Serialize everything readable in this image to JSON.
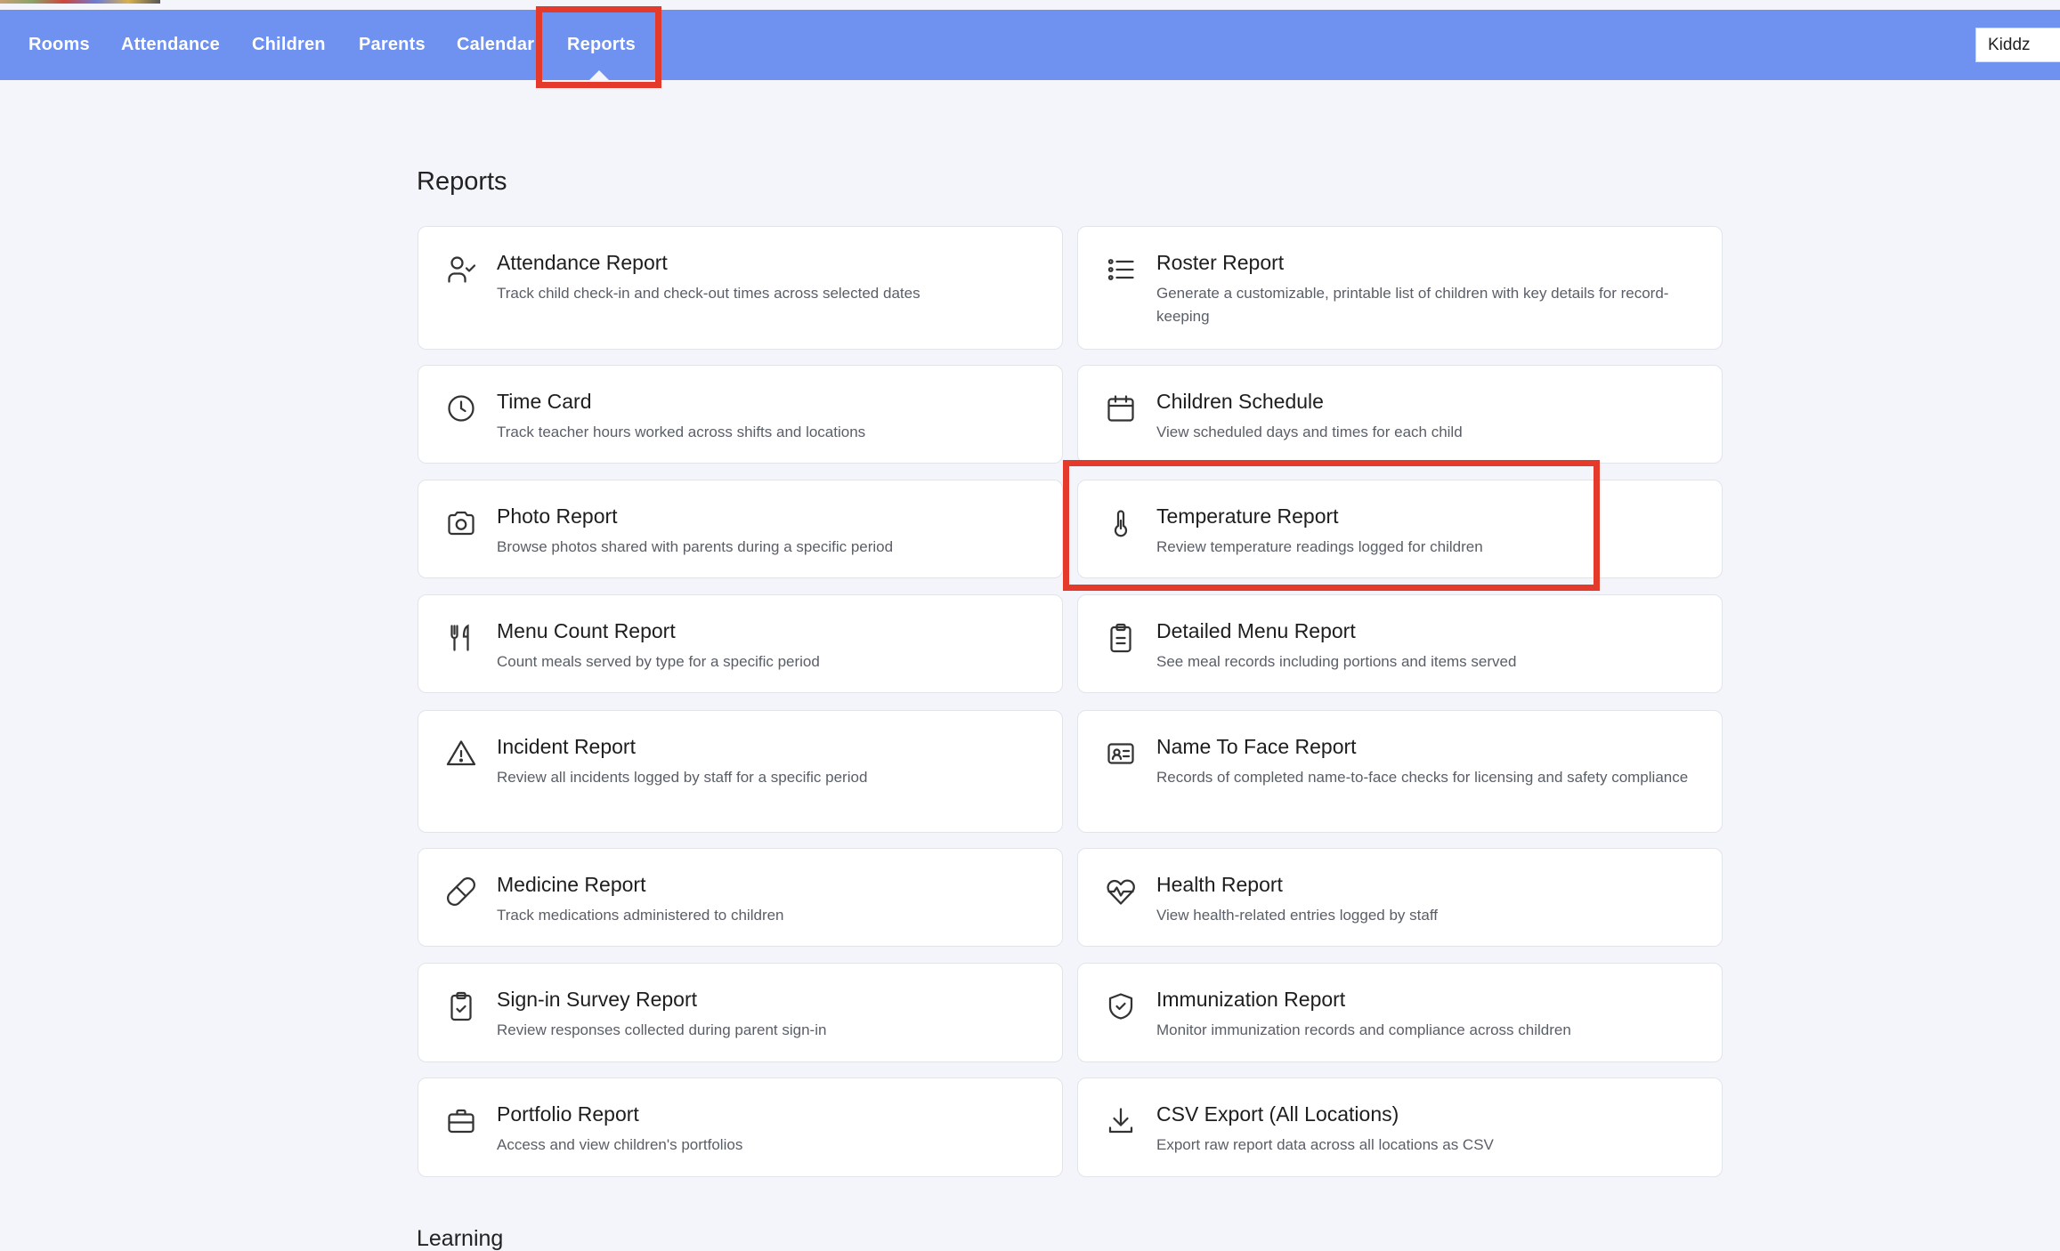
{
  "nav": {
    "items": [
      "Rooms",
      "Attendance",
      "Children",
      "Parents",
      "Calendar",
      "Reports"
    ],
    "active": "Reports",
    "brand_select_value": "Kiddz"
  },
  "reports_section": {
    "title": "Reports",
    "cards": [
      {
        "title": "Attendance Report",
        "description": "Track child check-in and check-out times across selected dates",
        "icon": "user-check-icon"
      },
      {
        "title": "Roster Report",
        "description": "Generate a customizable, printable list of children with key details for record-keeping",
        "icon": "list-icon"
      },
      {
        "title": "Time Card",
        "description": "Track teacher hours worked across shifts and locations",
        "icon": "clock-icon"
      },
      {
        "title": "Children Schedule",
        "description": "View scheduled days and times for each child",
        "icon": "calendar-icon"
      },
      {
        "title": "Photo Report",
        "description": "Browse photos shared with parents during a specific period",
        "icon": "camera-icon"
      },
      {
        "title": "Temperature Report",
        "description": "Review temperature readings logged for children",
        "icon": "thermometer-icon"
      },
      {
        "title": "Menu Count Report",
        "description": "Count meals served by type for a specific period",
        "icon": "utensils-icon"
      },
      {
        "title": "Detailed Menu Report",
        "description": "See meal records including portions and items served",
        "icon": "clipboard-icon"
      },
      {
        "title": "Incident Report",
        "description": "Review all incidents logged by staff for a specific period",
        "icon": "warning-icon"
      },
      {
        "title": "Name To Face Report",
        "description": "Records of completed name-to-face checks for licensing and safety compliance",
        "icon": "id-card-icon"
      },
      {
        "title": "Medicine Report",
        "description": "Track medications administered to children",
        "icon": "pill-icon"
      },
      {
        "title": "Health Report",
        "description": "View health-related entries logged by staff",
        "icon": "heart-pulse-icon"
      },
      {
        "title": "Sign-in Survey Report",
        "description": "Review responses collected during parent sign-in",
        "icon": "clipboard-check-icon"
      },
      {
        "title": "Immunization Report",
        "description": "Monitor immunization records and compliance across children",
        "icon": "shield-check-icon"
      },
      {
        "title": "Portfolio Report",
        "description": "Access and view children's portfolios",
        "icon": "briefcase-icon"
      },
      {
        "title": "CSV Export (All Locations)",
        "description": "Export raw report data across all locations as CSV",
        "icon": "download-icon"
      }
    ]
  },
  "learning_section": {
    "title": "Learning"
  },
  "colors": {
    "navbar": "#6f91ef",
    "highlight": "#e43a2b",
    "page_background": "#f4f5fa"
  }
}
